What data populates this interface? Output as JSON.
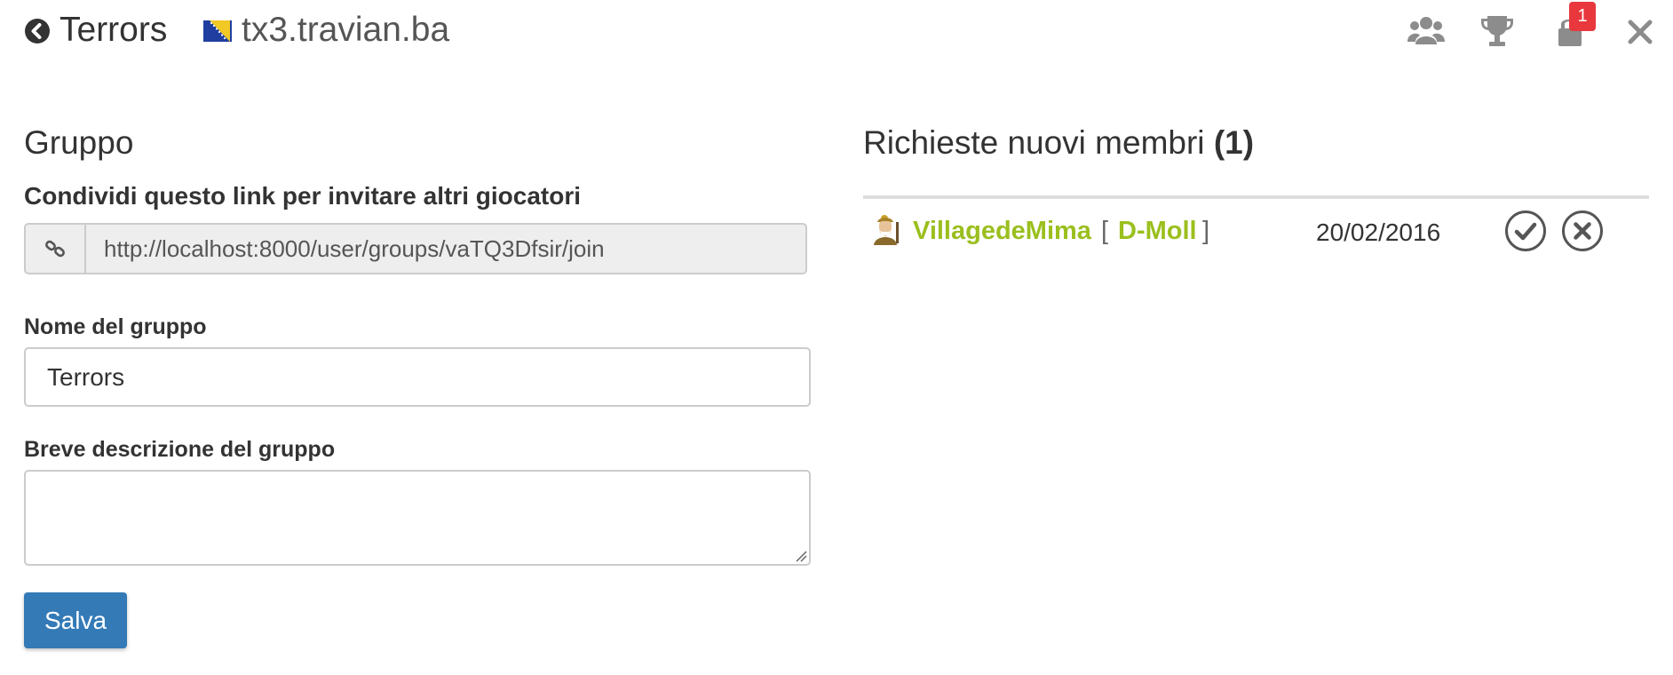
{
  "header": {
    "group_name": "Terrors",
    "server": "tx3.travian.ba",
    "notification_count": "1",
    "icons": [
      "chevron-circle-left-icon",
      "flag-icon",
      "users-icon",
      "trophy-icon",
      "lock-icon",
      "close-icon"
    ]
  },
  "group_section": {
    "title": "Gruppo",
    "share_label": "Condividi questo link per invitare altri giocatori",
    "invite_link": "http://localhost:8000/user/groups/vaTQ3Dfsir/join",
    "name_label": "Nome del gruppo",
    "name_value": "Terrors",
    "description_label": "Breve descrizione del gruppo",
    "description_value": "",
    "save_label": "Salva"
  },
  "requests_section": {
    "title": "Richieste nuovi membri",
    "count": "(1)",
    "items": [
      {
        "player": "VillagedeMima",
        "village": "D-Moll",
        "date": "20/02/2016"
      }
    ]
  },
  "colors": {
    "accent": "#9bbf1e",
    "primary_button": "#337ab7",
    "badge": "#e8383d"
  }
}
